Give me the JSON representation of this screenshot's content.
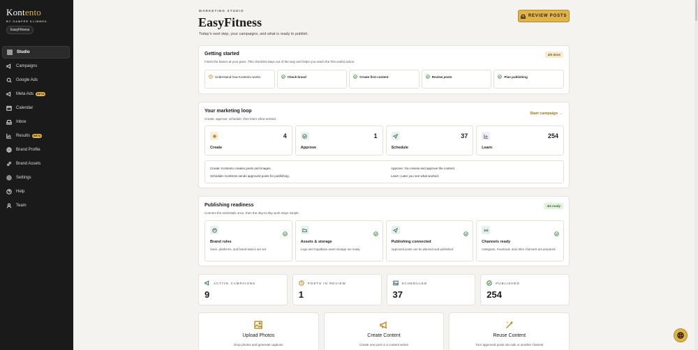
{
  "sidebar": {
    "brand_prefix": "Kont",
    "brand_accent": "ento",
    "brand_sub": "BY GAMPER KLIMMEK",
    "workspace": "EasyFitness",
    "items": [
      {
        "label": "Studio",
        "icon": "grid-icon"
      },
      {
        "label": "Campaigns",
        "icon": "megaphone-icon"
      },
      {
        "label": "Google Ads",
        "icon": "search-icon"
      },
      {
        "label": "Meta Ads",
        "icon": "megaphone-icon",
        "badge": "BETA"
      },
      {
        "label": "Calendar",
        "icon": "calendar-icon"
      },
      {
        "label": "Inbox",
        "icon": "inbox-icon"
      },
      {
        "label": "Results",
        "icon": "chart-icon",
        "badge": "BETA"
      },
      {
        "label": "Brand Profile",
        "icon": "globe-icon"
      },
      {
        "label": "Brand Assets",
        "icon": "link-icon"
      },
      {
        "label": "Settings",
        "icon": "gear-icon"
      },
      {
        "label": "Help",
        "icon": "help-icon"
      },
      {
        "label": "Team",
        "icon": "user-icon"
      }
    ]
  },
  "header": {
    "kicker": "MARKETING STUDIO",
    "title": "EasyFitness",
    "subtitle": "Today's next step, your campaigns, and what is ready to publish.",
    "review_button": "REVIEW POSTS"
  },
  "getting_started": {
    "title": "Getting started",
    "desc": "Finish the basics at your pace. This checklist stays out of the way and helps you reach the first useful action.",
    "progress": "4/5 done",
    "steps": [
      {
        "label": "Understand how Kontento works",
        "state": "todo"
      },
      {
        "label": "Check brand",
        "state": "done"
      },
      {
        "label": "Create first content",
        "state": "done"
      },
      {
        "label": "Review posts",
        "state": "done"
      },
      {
        "label": "Plan publishing",
        "state": "done"
      }
    ]
  },
  "loop": {
    "title": "Your marketing loop",
    "desc": "Create, approve, schedule, then learn what worked.",
    "cta": "Start campaign →",
    "tiles": [
      {
        "label": "Create",
        "value": "4",
        "icon": "sparkle-icon"
      },
      {
        "label": "Approve",
        "value": "1",
        "icon": "check-circle-icon"
      },
      {
        "label": "Schedule",
        "value": "37",
        "icon": "send-icon"
      },
      {
        "label": "Learn",
        "value": "254",
        "icon": "chart-icon"
      }
    ],
    "notes": {
      "create": "Create: Kontento creates posts and images.",
      "approve": "Approve: You review and approve the content.",
      "schedule": "Schedule: Kontento sends approved posts for publishing.",
      "learn": "Learn: Later you see what worked."
    }
  },
  "readiness": {
    "title": "Publishing readiness",
    "desc": "Connect the essentials once, then the day-to-day work stays simple.",
    "status": "4/4 ready",
    "items": [
      {
        "title": "Brand rules",
        "desc": "Voice, platforms, and brand basics are set.",
        "icon": "palette-icon"
      },
      {
        "title": "Assets & storage",
        "desc": "Logo and Supabase asset storage are ready.",
        "icon": "folder-icon"
      },
      {
        "title": "Publishing connected",
        "desc": "Approved posts can be planned and published.",
        "icon": "send-icon"
      },
      {
        "title": "Channels ready",
        "desc": "Instagram, Facebook, and other channels are prepared.",
        "icon": "broadcast-icon"
      }
    ]
  },
  "stats": [
    {
      "label": "ACTIVE CAMPAIGNS",
      "value": "9",
      "icon": "megaphone-icon"
    },
    {
      "label": "POSTS IN REVIEW",
      "value": "1",
      "icon": "clock-icon"
    },
    {
      "label": "SCHEDULED",
      "value": "37",
      "icon": "image-icon"
    },
    {
      "label": "PUBLISHED",
      "value": "254",
      "icon": "check-circle-icon"
    }
  ],
  "actions": [
    {
      "title": "Upload Photos",
      "desc": "Drop photos and generate captions",
      "icon": "image-icon"
    },
    {
      "title": "Create Content",
      "desc": "Create one post or a content series",
      "icon": "megaphone-icon"
    },
    {
      "title": "Reuse Content",
      "desc": "Turn approved posts into ads or another channel",
      "icon": "wand-icon"
    }
  ],
  "colors": {
    "accent": "#e0b24a",
    "sidebar_bg": "#1a1a1a",
    "page_bg": "#f4f3f0",
    "success": "#3c8a3a"
  }
}
